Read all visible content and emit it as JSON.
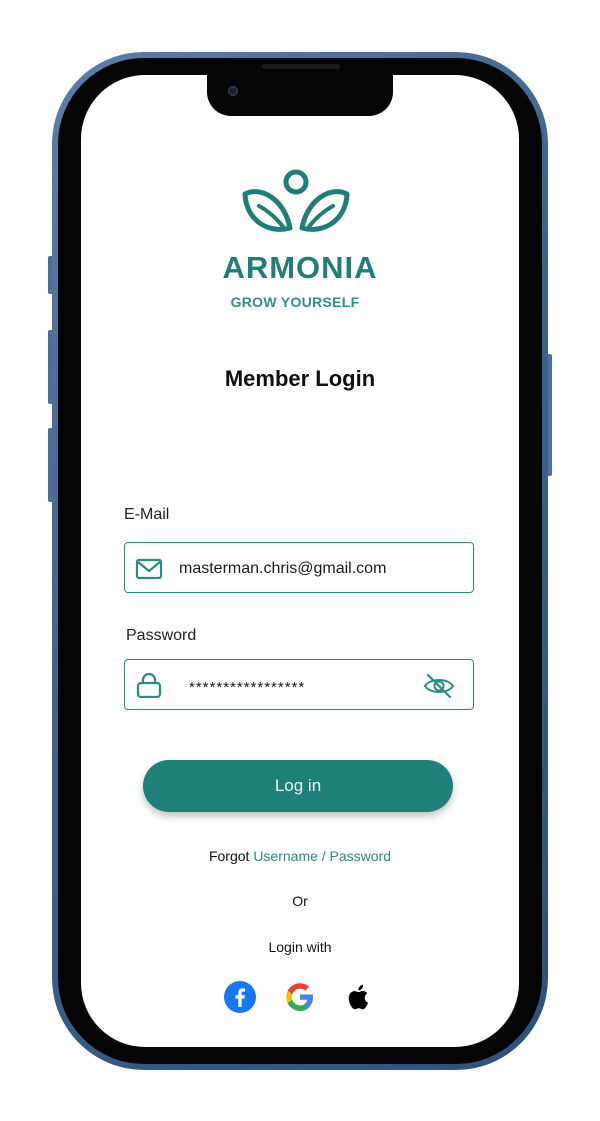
{
  "brand": {
    "name": "ARMONIA",
    "tagline": "GROW YOURSELF",
    "color": "#1f7e77"
  },
  "page": {
    "title": "Member Login"
  },
  "form": {
    "email": {
      "label": "E-Mail",
      "value": "masterman.chris@gmail.com",
      "icon": "mail-icon"
    },
    "password": {
      "label": "Password",
      "value": "*****************",
      "icon": "lock-icon",
      "toggle_icon": "eye-off-icon"
    },
    "submit_label": "Log in",
    "accent_color": "#1e8079"
  },
  "forgot": {
    "prefix": "Forgot",
    "link_text": "Username / Password"
  },
  "divider_text": "Or",
  "social": {
    "heading": "Login with",
    "providers": [
      {
        "name": "facebook",
        "icon": "facebook-icon",
        "color": "#1877f2"
      },
      {
        "name": "google",
        "icon": "google-icon",
        "color": "#4285f4"
      },
      {
        "name": "apple",
        "icon": "apple-icon",
        "color": "#000000"
      }
    ]
  }
}
